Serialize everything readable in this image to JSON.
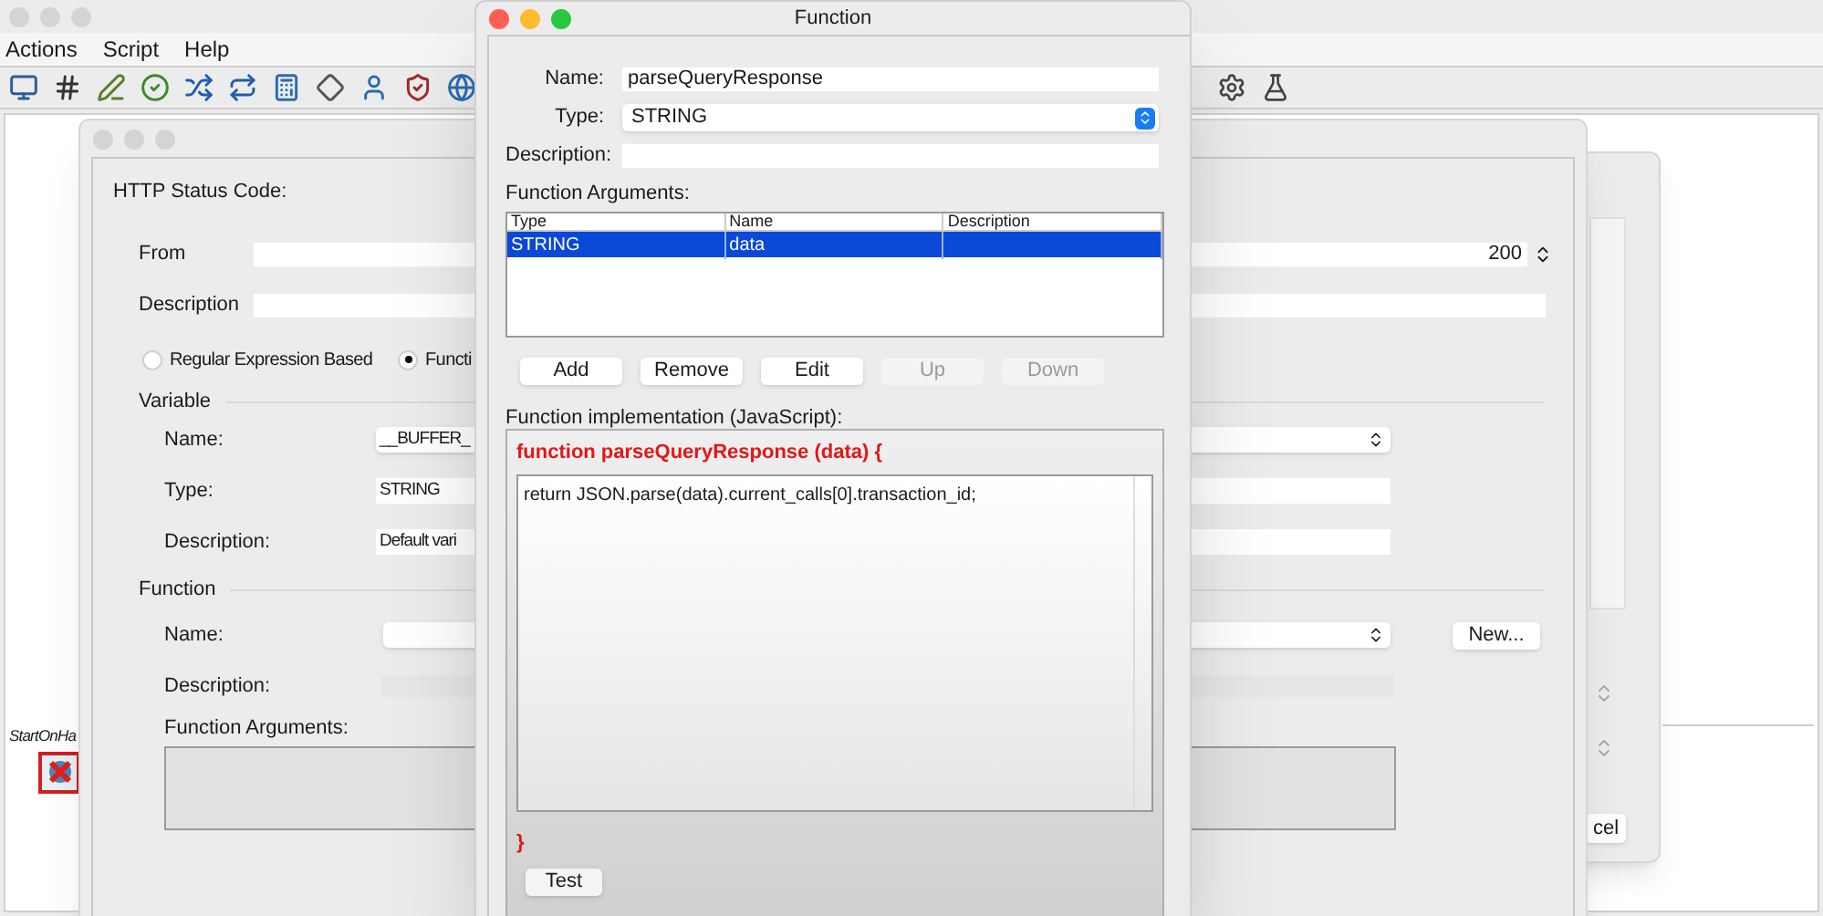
{
  "main_window": {
    "menu": [
      "Actions",
      "Script",
      "Help"
    ],
    "canvas": {
      "node_label": "StartOnHa"
    }
  },
  "back_dialog": {
    "button": "cel"
  },
  "status_dialog": {
    "heading": "HTTP Status Code:",
    "from": {
      "label": "From",
      "value": "200"
    },
    "description": {
      "label": "Description"
    },
    "radios": [
      {
        "label": "Regular Expression Based",
        "selected": false
      },
      {
        "label": "Functi",
        "selected": true
      }
    ],
    "variable": {
      "title": "Variable",
      "name_label": "Name:",
      "name_value": "__BUFFER_",
      "type_label": "Type:",
      "type_value": "STRING",
      "description_label": "Description:",
      "description_value": "Default vari"
    },
    "function": {
      "title": "Function",
      "name_label": "Name:",
      "new_button": "New...",
      "description_label": "Description:",
      "arguments_label": "Function Arguments:"
    }
  },
  "function_dialog": {
    "title": "Function",
    "name_label": "Name:",
    "name_value": "parseQueryResponse",
    "type_label": "Type:",
    "type_value": "STRING",
    "description_label": "Description:",
    "arguments_label": "Function Arguments:",
    "table": {
      "columns": [
        "Type",
        "Name",
        "Description"
      ],
      "rows": [
        {
          "cells": [
            "STRING",
            "data",
            ""
          ],
          "selected": true
        }
      ]
    },
    "buttons": [
      {
        "label": "Add",
        "disabled": false
      },
      {
        "label": "Remove",
        "disabled": false
      },
      {
        "label": "Edit",
        "disabled": false
      },
      {
        "label": "Up",
        "disabled": true
      },
      {
        "label": "Down",
        "disabled": true
      }
    ],
    "implementation_label": "Function implementation (JavaScript):",
    "signature": "function parseQueryResponse (data) {",
    "code": "return JSON.parse(data).current_calls[0].transaction_id;",
    "closing": "}",
    "test_button": "Test"
  }
}
